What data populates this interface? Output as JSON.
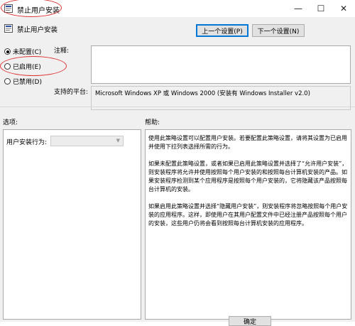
{
  "window": {
    "title": "禁止用户安装",
    "minimize_glyph": "—",
    "maximize_glyph": "☐",
    "close_glyph": "✕"
  },
  "policy": {
    "name": "禁止用户安装"
  },
  "nav": {
    "prev_label": "上一个设置(P)",
    "next_label": "下一个设置(N)"
  },
  "state": {
    "options": [
      {
        "label": "未配置(C)",
        "checked": true
      },
      {
        "label": "已启用(E)",
        "checked": false
      },
      {
        "label": "已禁用(D)",
        "checked": false
      }
    ]
  },
  "comment": {
    "label": "注释:",
    "value": ""
  },
  "supported": {
    "label": "支持的平台:",
    "value": "Microsoft Windows XP 或 Windows 2000 (安装有 Windows Installer v2.0)"
  },
  "options_section": {
    "label": "选项:",
    "behavior_label": "用户安装行为:",
    "behavior_value": ""
  },
  "help_section": {
    "label": "帮助:",
    "paragraphs": [
      "使用此策略设置可以配置用户安装。若要配置此策略设置，请将其设置为已启用并使用下拉列表选择所需的行为。",
      "如果未配置此策略设置，或者如果已启用此策略设置并选择了“允许用户安装”，则安装程序将允许并使用按照每个用户安装的和按照每台计算机安装的产品。如果安装程序检测到某个应用程序是按照每个用户安装的，它将隐藏该产品按照每台计算机的安装。",
      "如果启用此策略设置并选择“隐藏用户安装”，则安装程序将忽略按照每个用户安装的应用程序。这样，即使用户在其用户配置文件中已经注册产品按照每个用户的安装，这些用户仍将会看到按照每台计算机安装的应用程序。"
    ]
  },
  "footer": {
    "ok_label": "确定"
  },
  "colors": {
    "annotation": "#dd3333",
    "accent": "#0078d7"
  }
}
